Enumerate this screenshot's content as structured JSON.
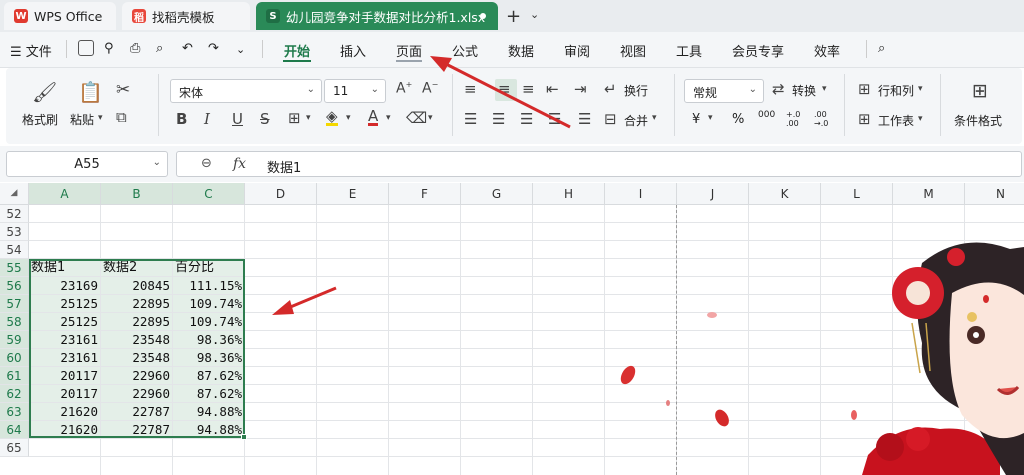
{
  "tabs": [
    {
      "label": "WPS Office",
      "icon": "wps-logo-icon"
    },
    {
      "label": "找稻壳模板",
      "icon": "daoke-icon"
    },
    {
      "label": "幼儿园竞争对手数据对比分析1.xlsx",
      "icon": "sheet-icon",
      "active": true
    }
  ],
  "menu": {
    "file": "文件",
    "items": [
      "开始",
      "插入",
      "页面",
      "公式",
      "数据",
      "审阅",
      "视图",
      "工具",
      "会员专享",
      "效率"
    ],
    "active": "开始"
  },
  "ribbon": {
    "format_painter": "格式刷",
    "paste": "粘贴",
    "font_name": "宋体",
    "font_size": "11",
    "wrap": "换行",
    "merge": "合并",
    "number_format": "常规",
    "convert": "转换",
    "row_col": "行和列",
    "worksheet": "工作表",
    "cond_format": "条件格式",
    "currency": "¥",
    "percent": "%",
    "thousands": "000",
    "inc_decimal": "+.0 .00",
    "dec_decimal": ".00 →.0"
  },
  "formula_bar": {
    "name_box": "A55",
    "fx": "fx",
    "content": "数据1"
  },
  "sheet": {
    "columns": [
      "A",
      "B",
      "C",
      "D",
      "E",
      "F",
      "G",
      "H",
      "I",
      "J",
      "K",
      "L",
      "M",
      "N"
    ],
    "rows": [
      "52",
      "53",
      "54",
      "55",
      "56",
      "57",
      "58",
      "59",
      "60",
      "61",
      "62",
      "63",
      "64",
      "65"
    ],
    "header": [
      "数据1",
      "数据2",
      "百分比"
    ],
    "data": [
      [
        "23169",
        "20845",
        "111.15%"
      ],
      [
        "25125",
        "22895",
        "109.74%"
      ],
      [
        "25125",
        "22895",
        "109.74%"
      ],
      [
        "23161",
        "23548",
        "98.36%"
      ],
      [
        "23161",
        "23548",
        "98.36%"
      ],
      [
        "20117",
        "22960",
        "87.62%"
      ],
      [
        "20117",
        "22960",
        "87.62%"
      ],
      [
        "21620",
        "22787",
        "94.88%"
      ],
      [
        "21620",
        "22787",
        "94.88%"
      ]
    ]
  },
  "colors": {
    "accent": "#1e7a4b",
    "doc_tab": "#2a8a58",
    "selection": "#2e7d4f",
    "arrow": "#d42a2a"
  }
}
